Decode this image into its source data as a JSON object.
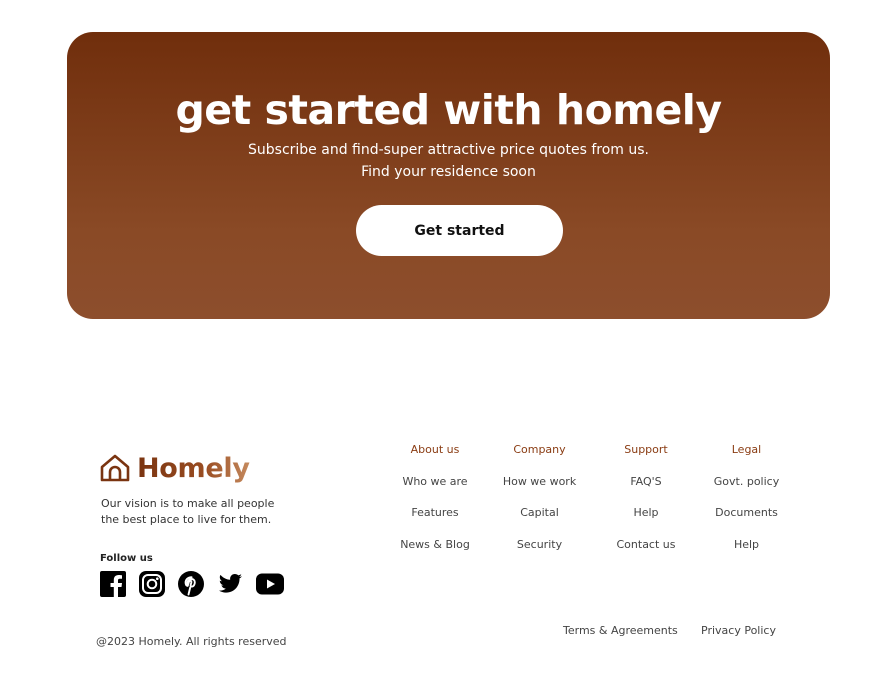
{
  "cta": {
    "title": "get started with homely",
    "subtitle_line1": "Subscribe and find-super attractive price quotes from us.",
    "subtitle_line2": "Find your residence soon",
    "button_label": "Get started"
  },
  "brand": {
    "name": "Homely",
    "vision": "Our vision is to make all people the best place to live for them.",
    "logo_icon": "house-icon"
  },
  "social": {
    "heading": "Follow us",
    "icons": [
      "facebook-icon",
      "instagram-icon",
      "pinterest-icon",
      "twitter-icon",
      "youtube-icon"
    ]
  },
  "columns": [
    {
      "heading": "About us",
      "links": [
        "Who we are",
        "Features",
        "News & Blog"
      ]
    },
    {
      "heading": "Company",
      "links": [
        "How we work",
        "Capital",
        "Security"
      ]
    },
    {
      "heading": "Support",
      "links": [
        "FAQ'S",
        "Help",
        "Contact us"
      ]
    },
    {
      "heading": "Legal",
      "links": [
        "Govt. policy",
        "Documents",
        "Help"
      ]
    }
  ],
  "footer": {
    "terms": "Terms & Agreements",
    "privacy": "Privacy Policy",
    "copyright": "@2023 Homely. All rights reserved"
  },
  "colors": {
    "accent": "#7a3410",
    "cta_gradient_top": "#702e0c",
    "cta_gradient_bottom": "#8d4e2d"
  }
}
